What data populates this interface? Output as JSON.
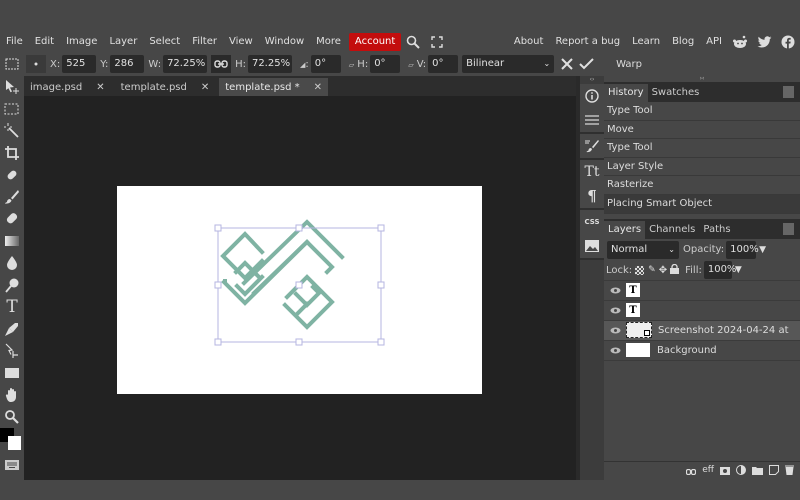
{
  "menu": {
    "items": [
      "File",
      "Edit",
      "Image",
      "Layer",
      "Select",
      "Filter",
      "View",
      "Window",
      "More"
    ],
    "account": "Account",
    "right_links": [
      "About",
      "Report a bug",
      "Learn",
      "Blog",
      "API"
    ],
    "icons": [
      "search-icon",
      "fullscreen-icon",
      "reddit-icon",
      "twitter-icon",
      "facebook-icon"
    ],
    "accent_color": "#c30d0d"
  },
  "options": {
    "x_label": "X:",
    "x_value": "525 px",
    "y_label": "Y:",
    "y_value": "286 px",
    "w_label": "W:",
    "w_value": "72.25%",
    "h_label": "H:",
    "h_value": "72.25%",
    "angle_label": ":",
    "angle_value": "0°",
    "skew_h_label": "H:",
    "skew_h_value": "0°",
    "skew_v_label": "V:",
    "skew_v_value": "0°",
    "interpolation": "Bilinear",
    "warp_label": "Warp"
  },
  "tabs": [
    {
      "label": "image.psd",
      "close": "✕"
    },
    {
      "label": "template.psd",
      "close": "✕"
    },
    {
      "label": "template.psd *",
      "close": "✕",
      "active": true
    }
  ],
  "tools": [
    "move-tool",
    "marquee-tool",
    "magic-wand-tool",
    "crop-tool",
    "healing-tool",
    "brush-tool",
    "eraser-tool",
    "gradient-tool",
    "blur-tool",
    "dodge-tool",
    "type-tool",
    "pen-tool",
    "path-select-tool",
    "shape-tool",
    "hand-tool",
    "zoom-tool"
  ],
  "type_tool_glyph": "T",
  "side_icons": {
    "css_label": "CSS"
  },
  "history": {
    "tabs": [
      "History",
      "Swatches"
    ],
    "items": [
      "Type Tool",
      "Move",
      "Type Tool",
      "Layer Style",
      "Rasterize",
      "Placing Smart Object"
    ]
  },
  "layers_panel": {
    "tabs": [
      "Layers",
      "Channels",
      "Paths"
    ],
    "blend_mode": "Normal",
    "opacity_label": "Opacity:",
    "opacity_value": "100%",
    "lock_label": "Lock:",
    "fill_label": "Fill:",
    "fill_value": "100%",
    "layers": [
      {
        "type": "text",
        "glyph": "T",
        "name": ""
      },
      {
        "type": "text",
        "glyph": "T",
        "name": ""
      },
      {
        "type": "smart",
        "name": "Screenshot 2024-04-24 at",
        "selected": true
      },
      {
        "type": "fill",
        "name": "Background"
      }
    ],
    "footer_glyph": "eff"
  },
  "logo_color": "#7fb3a3"
}
